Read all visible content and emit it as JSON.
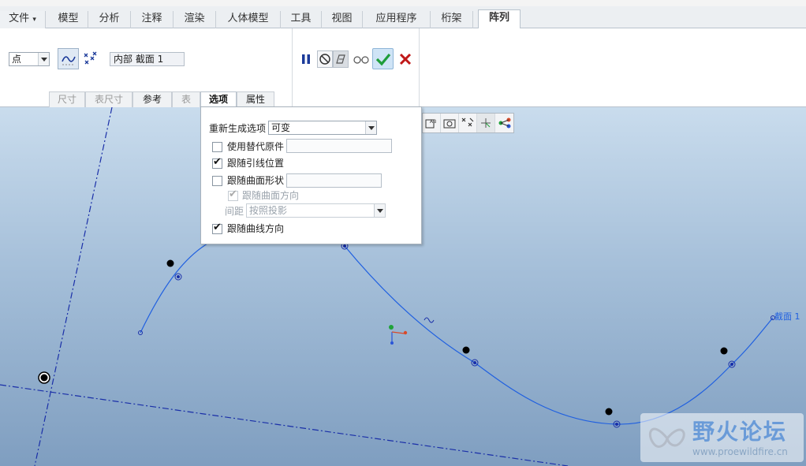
{
  "menu_tabs": [
    {
      "label": "文件",
      "has_menu": true
    },
    {
      "label": "模型"
    },
    {
      "label": "分析"
    },
    {
      "label": "注释"
    },
    {
      "label": "渲染"
    },
    {
      "label": "人体模型"
    },
    {
      "label": "工具"
    },
    {
      "label": "视图"
    },
    {
      "label": "应用程序"
    },
    {
      "label": "桁架"
    },
    {
      "label": "阵列",
      "active": true
    }
  ],
  "ribbon": {
    "pattern_type": "点",
    "section_reference": "内部 截面 1",
    "subtabs": [
      {
        "label": "尺寸",
        "enabled": false
      },
      {
        "label": "表尺寸",
        "enabled": false
      },
      {
        "label": "参考",
        "enabled": true
      },
      {
        "label": "表",
        "enabled": false
      },
      {
        "label": "选项",
        "enabled": true,
        "active": true
      },
      {
        "label": "属性",
        "enabled": true
      }
    ]
  },
  "options": {
    "regen_label": "重新生成选项",
    "regen_value": "可变",
    "use_alt_origin": {
      "label": "使用替代原件",
      "checked": false
    },
    "follow_leader": {
      "label": "跟随引线位置",
      "checked": true
    },
    "follow_surface_shape": {
      "label": "跟随曲面形状",
      "checked": false
    },
    "follow_surface_dir": {
      "label": "跟随曲面方向",
      "checked": true,
      "disabled": true
    },
    "spacing_label": "间距",
    "spacing_value": "按照投影",
    "follow_curve_dir": {
      "label": "跟随曲线方向",
      "checked": true
    }
  },
  "viewport": {
    "curve_label": "截面 1",
    "curve_color": "#2060e0",
    "datum_color": "#1a2fa8"
  },
  "watermark": {
    "title": "野火论坛",
    "url": "www.proewildfire.cn"
  },
  "colors": {
    "confirm": "#1f9d3a",
    "cancel": "#c01818",
    "pause": "#1b3a9a"
  }
}
